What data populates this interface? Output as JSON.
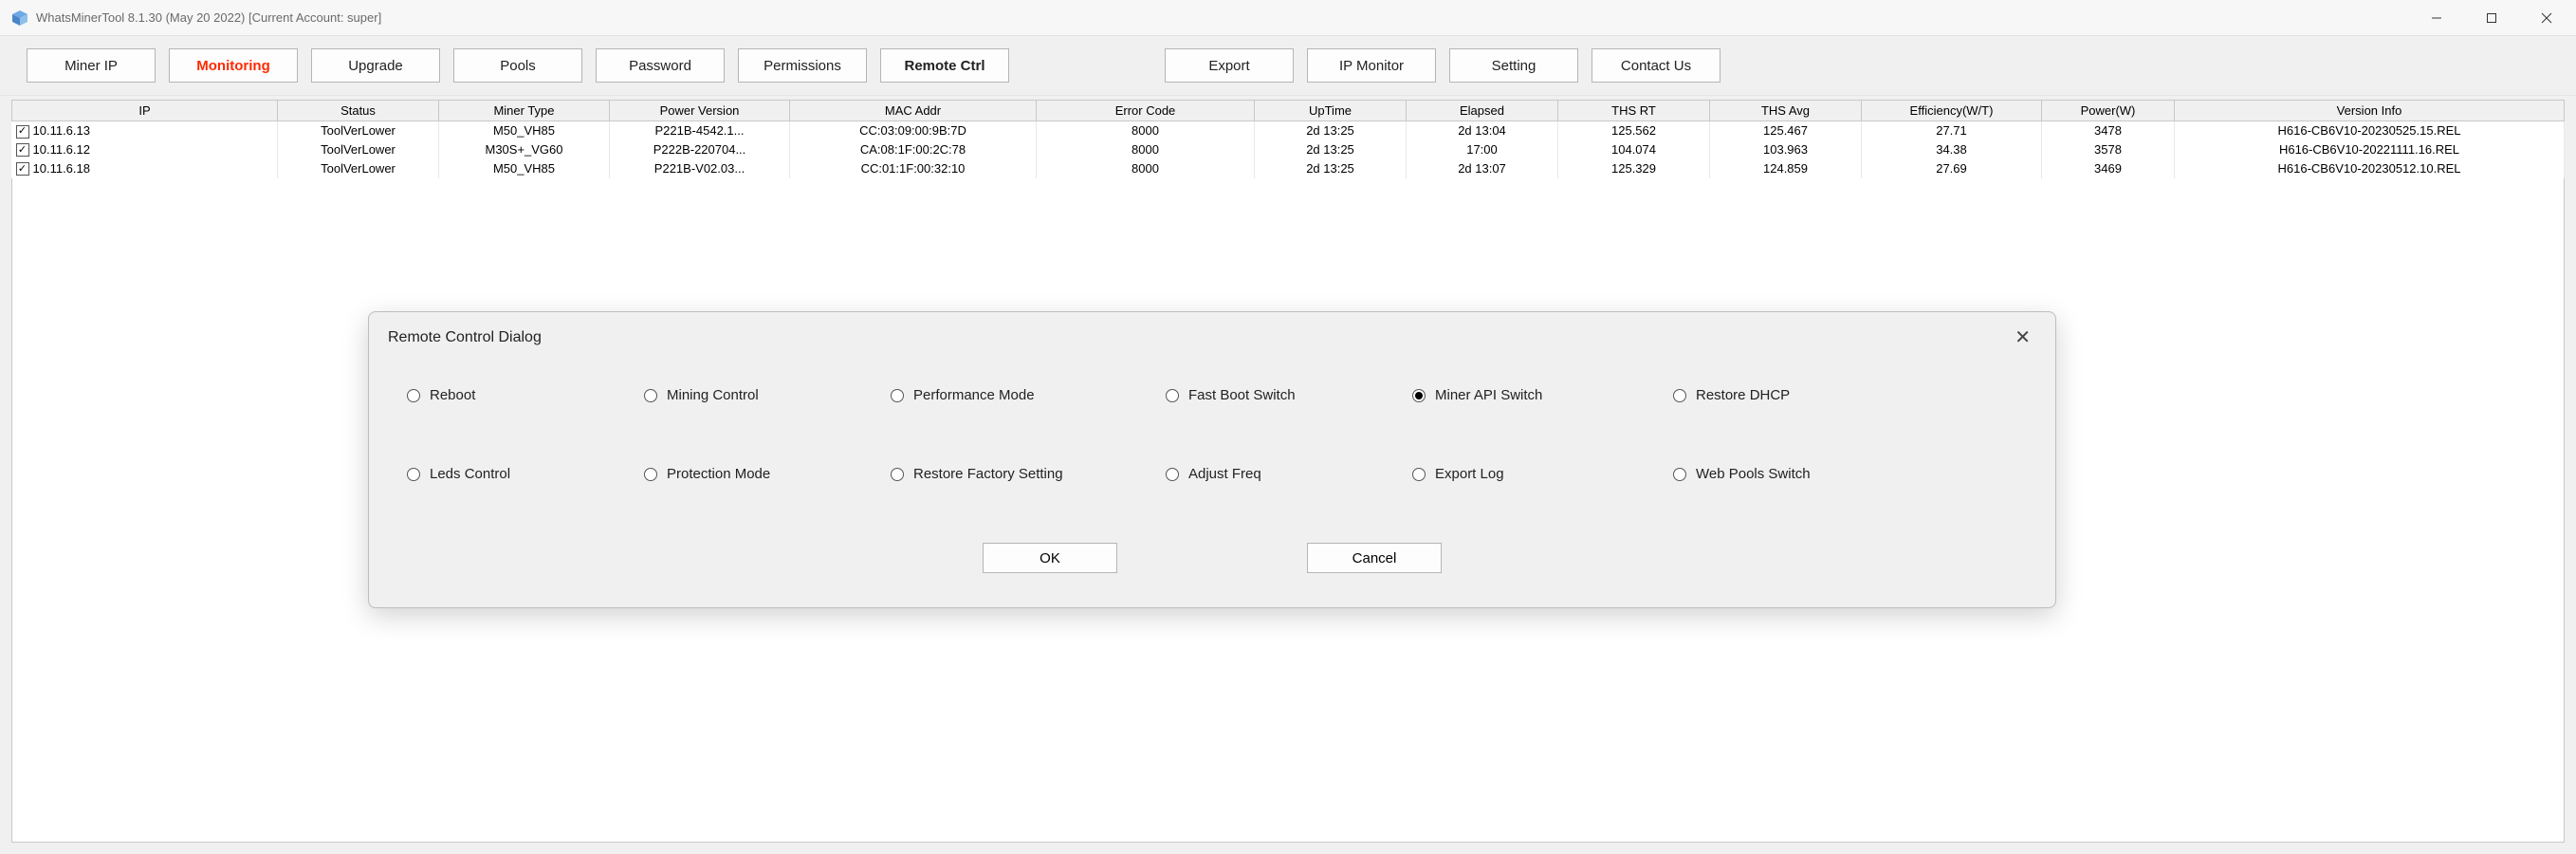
{
  "window": {
    "title": "WhatsMinerTool 8.1.30 (May 20 2022) [Current Account: super]"
  },
  "toolbar": {
    "miner_ip": "Miner IP",
    "monitoring": "Monitoring",
    "upgrade": "Upgrade",
    "pools": "Pools",
    "password": "Password",
    "permissions": "Permissions",
    "remote_ctrl": "Remote Ctrl",
    "export": "Export",
    "ip_monitor": "IP Monitor",
    "setting": "Setting",
    "contact_us": "Contact Us"
  },
  "columns": {
    "ip": "IP",
    "status": "Status",
    "miner_type": "Miner Type",
    "power_version": "Power Version",
    "mac": "MAC Addr",
    "error_code": "Error Code",
    "uptime": "UpTime",
    "elapsed": "Elapsed",
    "ths_rt": "THS RT",
    "ths_avg": "THS Avg",
    "efficiency": "Efficiency(W/T)",
    "power": "Power(W)",
    "version_info": "Version Info"
  },
  "rows": [
    {
      "checked": true,
      "ip": "10.11.6.13",
      "status": "ToolVerLower",
      "miner_type": "M50_VH85",
      "power_version": "P221B-4542.1...",
      "mac": "CC:03:09:00:9B:7D",
      "error_code": "8000",
      "uptime": "2d 13:25",
      "elapsed": "2d 13:04",
      "ths_rt": "125.562",
      "ths_avg": "125.467",
      "efficiency": "27.71",
      "power": "3478",
      "version_info": "H616-CB6V10-20230525.15.REL"
    },
    {
      "checked": true,
      "ip": "10.11.6.12",
      "status": "ToolVerLower",
      "miner_type": "M30S+_VG60",
      "power_version": "P222B-220704...",
      "mac": "CA:08:1F:00:2C:78",
      "error_code": "8000",
      "uptime": "2d 13:25",
      "elapsed": "17:00",
      "ths_rt": "104.074",
      "ths_avg": "103.963",
      "efficiency": "34.38",
      "power": "3578",
      "version_info": "H616-CB6V10-20221111.16.REL"
    },
    {
      "checked": true,
      "ip": "10.11.6.18",
      "status": "ToolVerLower",
      "miner_type": "M50_VH85",
      "power_version": "P221B-V02.03...",
      "mac": "CC:01:1F:00:32:10",
      "error_code": "8000",
      "uptime": "2d 13:25",
      "elapsed": "2d 13:07",
      "ths_rt": "125.329",
      "ths_avg": "124.859",
      "efficiency": "27.69",
      "power": "3469",
      "version_info": "H616-CB6V10-20230512.10.REL"
    }
  ],
  "dialog": {
    "title": "Remote Control Dialog",
    "options": {
      "reboot": "Reboot",
      "mining_control": "Mining Control",
      "performance_mode": "Performance Mode",
      "fast_boot_switch": "Fast Boot Switch",
      "miner_api_switch": "Miner API Switch",
      "restore_dhcp": "Restore DHCP",
      "leds_control": "Leds Control",
      "protection_mode": "Protection Mode",
      "restore_factory": "Restore Factory Setting",
      "adjust_freq": "Adjust Freq",
      "export_log": "Export Log",
      "web_pools_switch": "Web Pools Switch"
    },
    "selected": "miner_api_switch",
    "ok": "OK",
    "cancel": "Cancel"
  }
}
